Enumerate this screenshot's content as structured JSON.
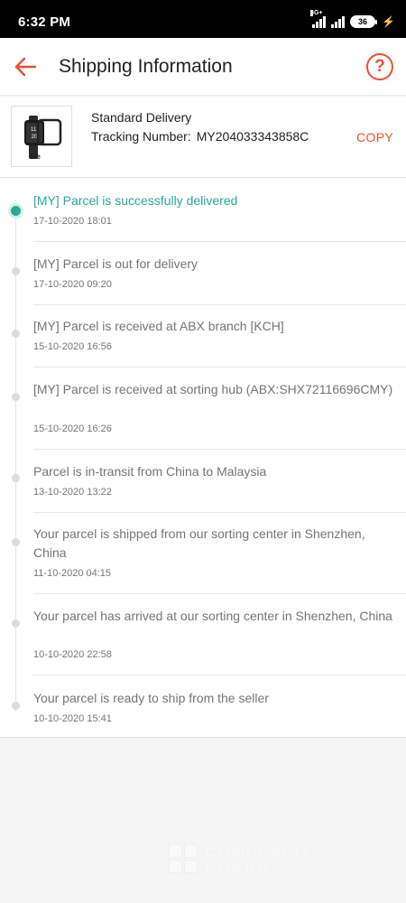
{
  "status_bar": {
    "time": "6:32 PM",
    "network": "4G+",
    "battery": "36"
  },
  "header": {
    "title": "Shipping Information",
    "back_icon": "arrow-left-icon",
    "help_icon": "question-circle-icon",
    "help_glyph": "?"
  },
  "delivery": {
    "method": "Standard Delivery",
    "tracking_label": "Tracking Number:",
    "tracking_number": "MY204033343858C",
    "copy_label": "COPY",
    "product_badge": "lite"
  },
  "colors": {
    "accent": "#ee4d2d",
    "delivered": "#26aa99",
    "muted": "#757575"
  },
  "events": [
    {
      "text": "[MY] Parcel is successfully delivered",
      "time": "17-10-2020 18:01"
    },
    {
      "text": "[MY] Parcel is out for delivery",
      "time": "17-10-2020 09:20"
    },
    {
      "text": "[MY] Parcel is received at ABX branch [KCH]",
      "time": "15-10-2020 16:56"
    },
    {
      "text": "[MY] Parcel is received at sorting hub (ABX:SHX72116696CMY)",
      "time": "15-10-2020 16:26"
    },
    {
      "text": "Parcel is in-transit from China to Malaysia",
      "time": "13-10-2020 13:22"
    },
    {
      "text": "Your parcel is shipped from our sorting center in Shenzhen, China",
      "time": "11-10-2020 04:15"
    },
    {
      "text": "Your parcel has arrived at our sorting center in Shenzhen, China",
      "time": "10-10-2020 22:58"
    },
    {
      "text": "Your parcel is ready to ship from the seller",
      "time": "10-10-2020 15:41"
    }
  ],
  "watermark": {
    "line1": "COMPLAINTS",
    "line2": "BOARD"
  }
}
